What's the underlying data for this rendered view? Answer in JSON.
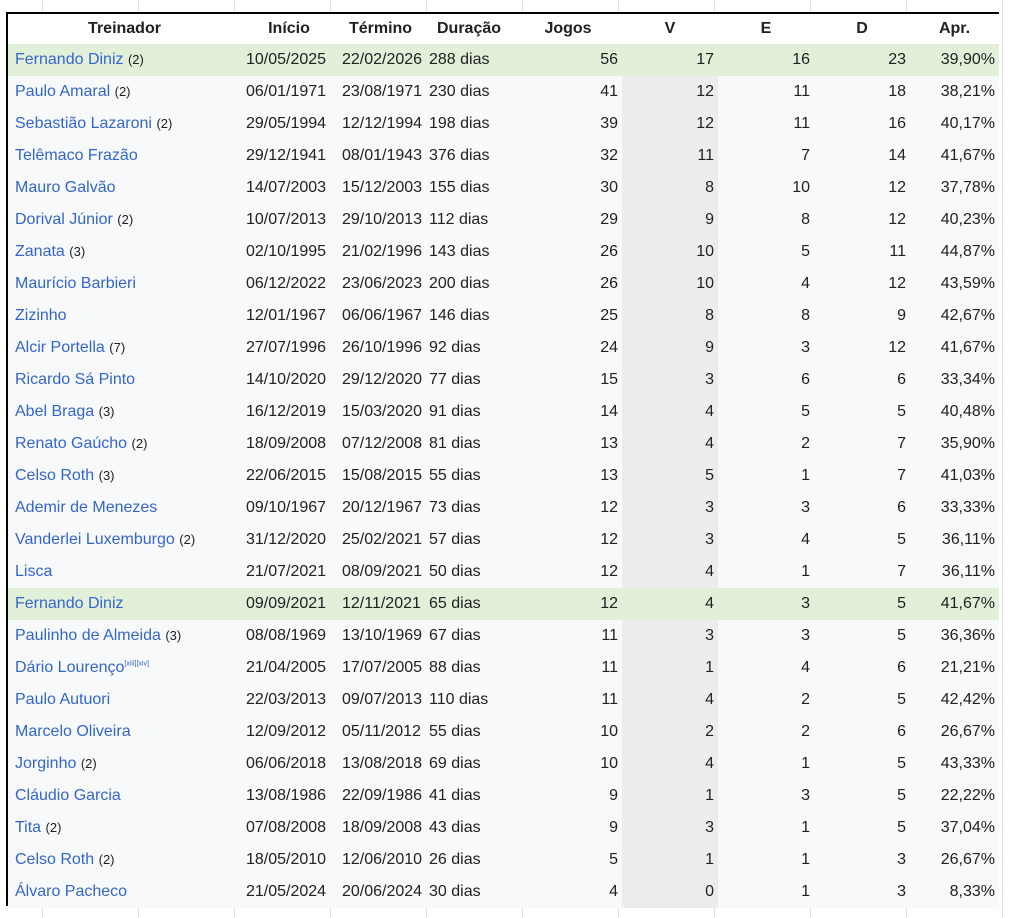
{
  "headers": [
    "Treinador",
    "Início",
    "Término",
    "Duração",
    "Jogos",
    "V",
    "E",
    "D",
    "Apr."
  ],
  "rows": [
    {
      "name": "Fernando Diniz",
      "count": "(2)",
      "sup": "",
      "start": "10/05/2025",
      "end": "22/02/2026",
      "duration": "288 dias",
      "jogos": "56",
      "v": "17",
      "e": "16",
      "d": "23",
      "apr": "39,90%",
      "highlight": true
    },
    {
      "name": "Paulo Amaral",
      "count": "(2)",
      "sup": "",
      "start": "06/01/1971",
      "end": "23/08/1971",
      "duration": "230 dias",
      "jogos": "41",
      "v": "12",
      "e": "11",
      "d": "18",
      "apr": "38,21%",
      "highlight": false
    },
    {
      "name": "Sebastião Lazaroni",
      "count": "(2)",
      "sup": "",
      "start": "29/05/1994",
      "end": "12/12/1994",
      "duration": "198 dias",
      "jogos": "39",
      "v": "12",
      "e": "11",
      "d": "16",
      "apr": "40,17%",
      "highlight": false
    },
    {
      "name": "Telêmaco Frazão",
      "count": "",
      "sup": "",
      "start": "29/12/1941",
      "end": "08/01/1943",
      "duration": "376 dias",
      "jogos": "32",
      "v": "11",
      "e": "7",
      "d": "14",
      "apr": "41,67%",
      "highlight": false
    },
    {
      "name": "Mauro Galvão",
      "count": "",
      "sup": "",
      "start": "14/07/2003",
      "end": "15/12/2003",
      "duration": "155 dias",
      "jogos": "30",
      "v": "8",
      "e": "10",
      "d": "12",
      "apr": "37,78%",
      "highlight": false
    },
    {
      "name": "Dorival Júnior",
      "count": "(2)",
      "sup": "",
      "start": "10/07/2013",
      "end": "29/10/2013",
      "duration": "112 dias",
      "jogos": "29",
      "v": "9",
      "e": "8",
      "d": "12",
      "apr": "40,23%",
      "highlight": false
    },
    {
      "name": "Zanata",
      "count": "(3)",
      "sup": "",
      "start": "02/10/1995",
      "end": "21/02/1996",
      "duration": "143 dias",
      "jogos": "26",
      "v": "10",
      "e": "5",
      "d": "11",
      "apr": "44,87%",
      "highlight": false
    },
    {
      "name": "Maurício Barbieri",
      "count": "",
      "sup": "",
      "start": "06/12/2022",
      "end": "23/06/2023",
      "duration": "200 dias",
      "jogos": "26",
      "v": "10",
      "e": "4",
      "d": "12",
      "apr": "43,59%",
      "highlight": false
    },
    {
      "name": "Zizinho",
      "count": "",
      "sup": "",
      "start": "12/01/1967",
      "end": "06/06/1967",
      "duration": "146 dias",
      "jogos": "25",
      "v": "8",
      "e": "8",
      "d": "9",
      "apr": "42,67%",
      "highlight": false
    },
    {
      "name": "Alcir Portella",
      "count": "(7)",
      "sup": "",
      "start": "27/07/1996",
      "end": "26/10/1996",
      "duration": "92 dias",
      "jogos": "24",
      "v": "9",
      "e": "3",
      "d": "12",
      "apr": "41,67%",
      "highlight": false
    },
    {
      "name": "Ricardo Sá Pinto",
      "count": "",
      "sup": "",
      "start": "14/10/2020",
      "end": "29/12/2020",
      "duration": "77 dias",
      "jogos": "15",
      "v": "3",
      "e": "6",
      "d": "6",
      "apr": "33,34%",
      "highlight": false
    },
    {
      "name": "Abel Braga",
      "count": "(3)",
      "sup": "",
      "start": "16/12/2019",
      "end": "15/03/2020",
      "duration": "91 dias",
      "jogos": "14",
      "v": "4",
      "e": "5",
      "d": "5",
      "apr": "40,48%",
      "highlight": false
    },
    {
      "name": "Renato Gaúcho",
      "count": "(2)",
      "sup": "",
      "start": "18/09/2008",
      "end": "07/12/2008",
      "duration": "81 dias",
      "jogos": "13",
      "v": "4",
      "e": "2",
      "d": "7",
      "apr": "35,90%",
      "highlight": false
    },
    {
      "name": "Celso Roth",
      "count": "(3)",
      "sup": "",
      "start": "22/06/2015",
      "end": "15/08/2015",
      "duration": "55 dias",
      "jogos": "13",
      "v": "5",
      "e": "1",
      "d": "7",
      "apr": "41,03%",
      "highlight": false
    },
    {
      "name": "Ademir de Menezes",
      "count": "",
      "sup": "",
      "start": "09/10/1967",
      "end": "20/12/1967",
      "duration": "73 dias",
      "jogos": "12",
      "v": "3",
      "e": "3",
      "d": "6",
      "apr": "33,33%",
      "highlight": false
    },
    {
      "name": "Vanderlei Luxemburgo",
      "count": "(2)",
      "sup": "",
      "start": "31/12/2020",
      "end": "25/02/2021",
      "duration": "57 dias",
      "jogos": "12",
      "v": "3",
      "e": "4",
      "d": "5",
      "apr": "36,11%",
      "highlight": false
    },
    {
      "name": "Lisca",
      "count": "",
      "sup": "",
      "start": "21/07/2021",
      "end": "08/09/2021",
      "duration": "50 dias",
      "jogos": "12",
      "v": "4",
      "e": "1",
      "d": "7",
      "apr": "36,11%",
      "highlight": false
    },
    {
      "name": "Fernando Diniz",
      "count": "",
      "sup": "",
      "start": "09/09/2021",
      "end": "12/11/2021",
      "duration": "65 dias",
      "jogos": "12",
      "v": "4",
      "e": "3",
      "d": "5",
      "apr": "41,67%",
      "highlight": true
    },
    {
      "name": "Paulinho de Almeida",
      "count": "(3)",
      "sup": "",
      "start": "08/08/1969",
      "end": "13/10/1969",
      "duration": "67 dias",
      "jogos": "11",
      "v": "3",
      "e": "3",
      "d": "5",
      "apr": "36,36%",
      "highlight": false
    },
    {
      "name": "Dário Lourenço",
      "count": "",
      "sup": "[xiii][xiv]",
      "start": "21/04/2005",
      "end": "17/07/2005",
      "duration": "88 dias",
      "jogos": "11",
      "v": "1",
      "e": "4",
      "d": "6",
      "apr": "21,21%",
      "highlight": false
    },
    {
      "name": "Paulo Autuori",
      "count": "",
      "sup": "",
      "start": "22/03/2013",
      "end": "09/07/2013",
      "duration": "110 dias",
      "jogos": "11",
      "v": "4",
      "e": "2",
      "d": "5",
      "apr": "42,42%",
      "highlight": false
    },
    {
      "name": "Marcelo Oliveira",
      "count": "",
      "sup": "",
      "start": "12/09/2012",
      "end": "05/11/2012",
      "duration": "55 dias",
      "jogos": "10",
      "v": "2",
      "e": "2",
      "d": "6",
      "apr": "26,67%",
      "highlight": false
    },
    {
      "name": "Jorginho",
      "count": "(2)",
      "sup": "",
      "start": "06/06/2018",
      "end": "13/08/2018",
      "duration": "69 dias",
      "jogos": "10",
      "v": "4",
      "e": "1",
      "d": "5",
      "apr": "43,33%",
      "highlight": false
    },
    {
      "name": "Cláudio Garcia",
      "count": "",
      "sup": "",
      "start": "13/08/1986",
      "end": "22/09/1986",
      "duration": "41 dias",
      "jogos": "9",
      "v": "1",
      "e": "3",
      "d": "5",
      "apr": "22,22%",
      "highlight": false
    },
    {
      "name": "Tita",
      "count": "(2)",
      "sup": "",
      "start": "07/08/2008",
      "end": "18/09/2008",
      "duration": "43 dias",
      "jogos": "9",
      "v": "3",
      "e": "1",
      "d": "5",
      "apr": "37,04%",
      "highlight": false
    },
    {
      "name": "Celso Roth",
      "count": "(2)",
      "sup": "",
      "start": "18/05/2010",
      "end": "12/06/2010",
      "duration": "26 dias",
      "jogos": "5",
      "v": "1",
      "e": "1",
      "d": "3",
      "apr": "26,67%",
      "highlight": false
    },
    {
      "name": "Álvaro Pacheco",
      "count": "",
      "sup": "",
      "start": "21/05/2024",
      "end": "20/06/2024",
      "duration": "30 dias",
      "jogos": "4",
      "v": "0",
      "e": "1",
      "d": "3",
      "apr": "8,33%",
      "highlight": false
    }
  ]
}
